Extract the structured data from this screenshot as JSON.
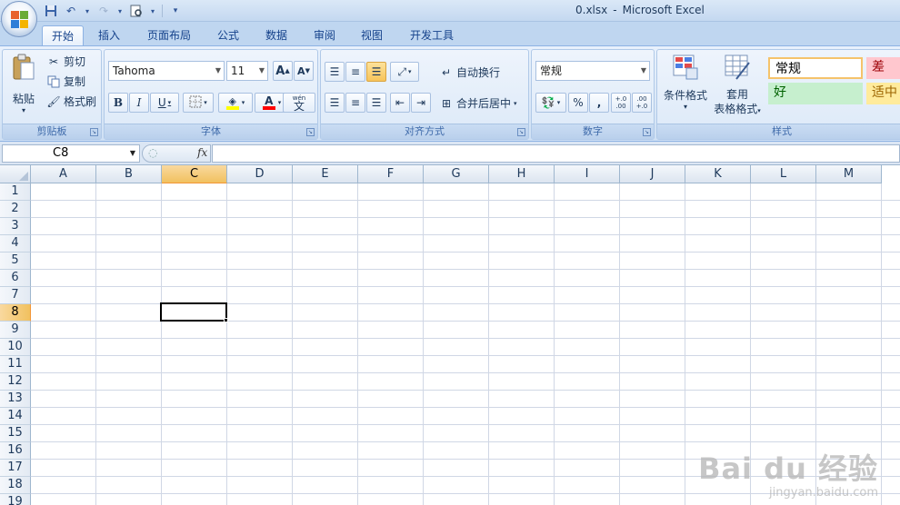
{
  "window": {
    "file": "0.xlsx",
    "separator": "-",
    "app": "Microsoft Excel"
  },
  "quick_access": {
    "icons": [
      "save-icon",
      "undo-icon",
      "redo-icon",
      "print-preview-icon",
      "customize-icon"
    ]
  },
  "tabs": [
    "开始",
    "插入",
    "页面布局",
    "公式",
    "数据",
    "审阅",
    "视图",
    "开发工具"
  ],
  "ribbon": {
    "clipboard": {
      "paste": "粘贴",
      "cut": "剪切",
      "copy": "复制",
      "format_painter": "格式刷",
      "label": "剪贴板"
    },
    "font": {
      "name": "Tahoma",
      "size": "11",
      "grow": "A",
      "shrink": "A",
      "bold": "B",
      "italic": "I",
      "underline": "U",
      "font_color": "A",
      "phonetic": "wén",
      "phonetic_char": "文",
      "label": "字体"
    },
    "alignment": {
      "wrap_text": "自动换行",
      "merge_center": "合并后居中",
      "label": "对齐方式"
    },
    "number": {
      "format": "常规",
      "percent": "%",
      "comma": ",",
      "inc_decimal": "+.0 .00",
      "dec_decimal": ".00 +.0",
      "label": "数字"
    },
    "styles": {
      "conditional": "条件格式",
      "table_line1": "套用",
      "table_line2": "表格格式",
      "normal": "常规",
      "bad": "差",
      "good": "好",
      "neutral": "适中",
      "label": "样式"
    }
  },
  "formula_bar": {
    "name_box": "C8",
    "fx": "fx",
    "content": ""
  },
  "sheet": {
    "columns": [
      "A",
      "B",
      "C",
      "D",
      "E",
      "F",
      "G",
      "H",
      "I",
      "J",
      "K",
      "L",
      "M"
    ],
    "rows": [
      "1",
      "2",
      "3",
      "4",
      "5",
      "6",
      "7",
      "8",
      "9",
      "10",
      "11",
      "12",
      "13",
      "14",
      "15",
      "16",
      "17",
      "18",
      "19"
    ],
    "selected_column": "C",
    "selected_row": "8"
  },
  "watermark": {
    "main": "Bai du 经验",
    "sub": "jingyan.baidu.com"
  },
  "colors": {
    "accent": "#15428b",
    "selection_header": "#f1c15f",
    "bad_bg": "#ffc7ce",
    "good_bg": "#c6efce",
    "neutral_bg": "#ffeb9c"
  }
}
